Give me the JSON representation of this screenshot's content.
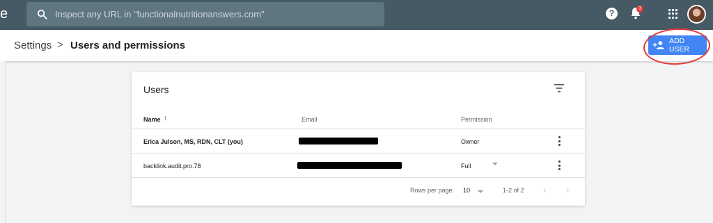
{
  "topbar": {
    "brand_fragment": "e",
    "search_placeholder": "Inspect any URL in \"functionalnutritionanswers.com\"",
    "help_glyph": "?",
    "notification_count": "3"
  },
  "breadcrumb": {
    "parent": "Settings",
    "separator": ">",
    "current": "Users and permissions"
  },
  "actions": {
    "add_user_label": "ADD USER"
  },
  "card": {
    "title": "Users",
    "columns": {
      "name": "Name",
      "sort_indicator": "↑",
      "email": "Email",
      "permission": "Permission"
    },
    "rows": [
      {
        "name": "Erica Julson, MS, RDN, CLT (you)",
        "email": "",
        "permission": "Owner"
      },
      {
        "name": "backlink.audit.pro.78",
        "email": "",
        "permission": "Full"
      }
    ],
    "pagination": {
      "rows_per_page_label": "Rows per page:",
      "rows_per_page_value": "10",
      "range": "1-2 of 2",
      "prev": "‹",
      "next": "›"
    }
  },
  "colors": {
    "topbar": "#455a64",
    "accent": "#4285f4",
    "annotation": "#e53935"
  }
}
